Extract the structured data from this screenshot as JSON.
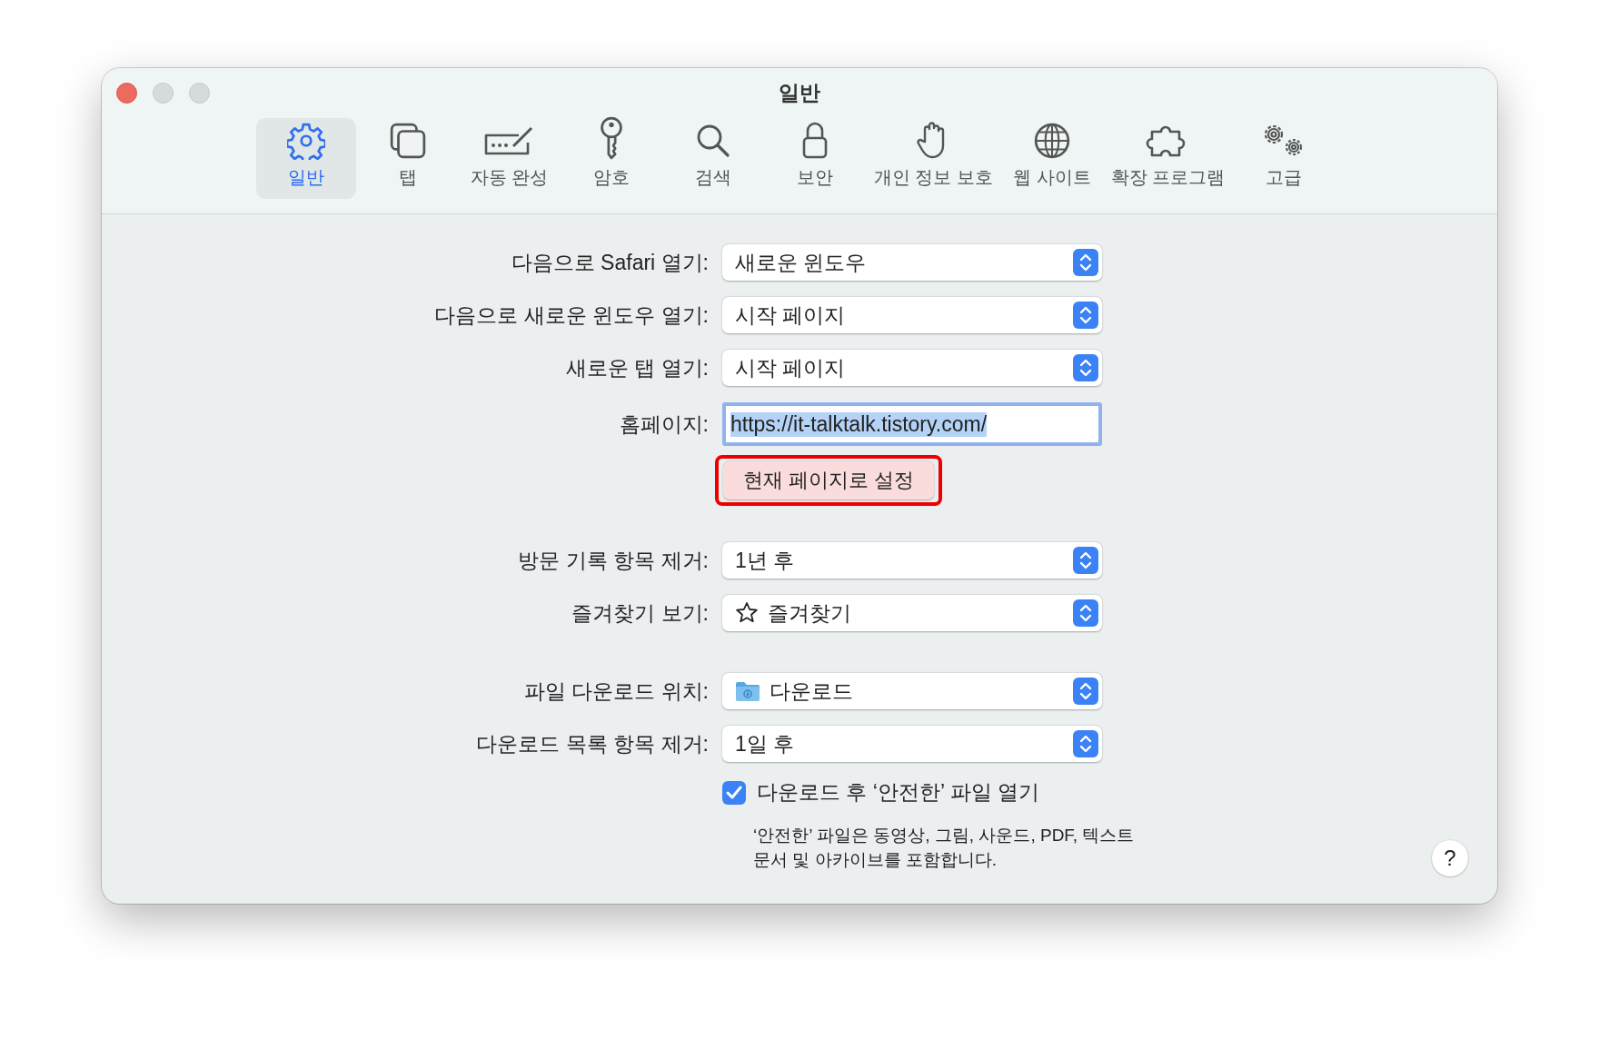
{
  "window": {
    "title": "일반"
  },
  "tabs": [
    {
      "label": "일반",
      "selected": true
    },
    {
      "label": "탭",
      "selected": false
    },
    {
      "label": "자동 완성",
      "selected": false
    },
    {
      "label": "암호",
      "selected": false
    },
    {
      "label": "검색",
      "selected": false
    },
    {
      "label": "보안",
      "selected": false
    },
    {
      "label": "개인 정보 보호",
      "selected": false
    },
    {
      "label": "웹 사이트",
      "selected": false
    },
    {
      "label": "확장 프로그램",
      "selected": false
    },
    {
      "label": "고급",
      "selected": false
    }
  ],
  "groups": [
    [
      {
        "kind": "popup",
        "label": "다음으로 Safari 열기:",
        "value": "새로운 윈도우"
      },
      {
        "kind": "popup",
        "label": "다음으로 새로운 윈도우 열기:",
        "value": "시작 페이지"
      },
      {
        "kind": "popup",
        "label": "새로운 탭 열기:",
        "value": "시작 페이지"
      },
      {
        "kind": "text-field",
        "label": "홈페이지:",
        "value": "https://it-talktalk.tistory.com/",
        "focused": true
      },
      {
        "kind": "button",
        "label": "현재 페이지로 설정",
        "highlighted": true
      }
    ],
    [
      {
        "kind": "popup",
        "label": "방문 기록 항목 제거:",
        "value": "1년 후"
      },
      {
        "kind": "star-popup",
        "label": "즐겨찾기 보기:",
        "value": "즐겨찾기"
      }
    ],
    [
      {
        "kind": "folder-popup",
        "label": "파일 다운로드 위치:",
        "value": "다운로드"
      },
      {
        "kind": "popup",
        "label": "다운로드 목록 항목 제거:",
        "value": "1일 후"
      },
      {
        "kind": "checkbox",
        "label": "다운로드 후 ‘안전한’ 파일 열기",
        "checked": true
      },
      {
        "kind": "note",
        "lines": [
          "‘안전한’ 파일은 동영상, 그림, 사운드, PDF, 텍스트",
          "문서 및 아카이브를 포함합니다."
        ]
      }
    ]
  ],
  "help_button": {
    "label": "?"
  }
}
